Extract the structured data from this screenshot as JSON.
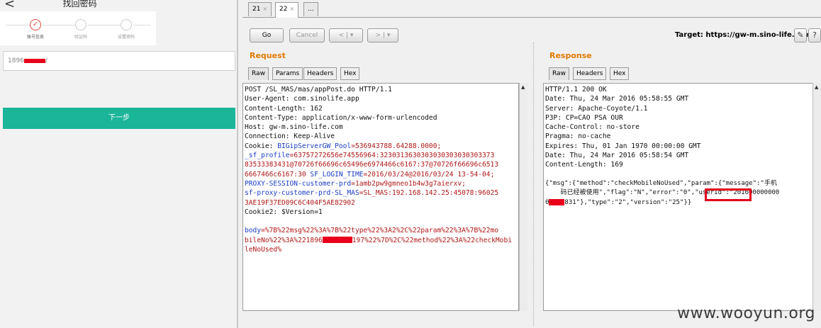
{
  "mobile": {
    "back_glyph": "<",
    "title": "找回密码",
    "steps": [
      "账号信息",
      "验证码",
      "设置密码"
    ],
    "step_done_glyph": "✓",
    "phone_prefix": "1896",
    "phone_suffix": "/",
    "next_label": "下一步"
  },
  "burp": {
    "tabs": [
      {
        "label": "21",
        "close": "×"
      },
      {
        "label": "22",
        "close": "×"
      },
      {
        "label": "...",
        "close": ""
      }
    ],
    "toolbar": {
      "go": "Go",
      "cancel": "Cancel",
      "back": "< | ▾",
      "forward": "> | ▾",
      "target": "Target: https://gw-m.sino-life.com",
      "edit_glyph": "✎",
      "help_glyph": "?"
    },
    "request": {
      "heading": "Request",
      "tabs": [
        "Raw",
        "Params",
        "Headers",
        "Hex"
      ],
      "lines": [
        "POST /SL_MAS/mas/appPost.do HTTP/1.1",
        "User-Agent: com.sinolife.app",
        "Content-Length: 162",
        "Content-Type: application/x-www-form-urlencoded",
        "Host: gw-m.sino-life.com",
        "Connection: Keep-Alive"
      ],
      "cookie_label": "Cookie: ",
      "cookie_lines": [
        {
          "k": "BIGipServerGW_Pool",
          "v": "=536943788.64288.0000;"
        },
        {
          "k": "_sf_profile",
          "v": "=63757272656e74556964:3230313630303030303030303373"
        },
        {
          "k": "",
          "v": "83533383431@70726f66696c65496e6974466c6167:37@70726f66696c6513"
        },
        {
          "k": "",
          "v": "6667466c6167:30 "
        },
        {
          "k": "SF_LOGIN_TIME",
          "v": "=2016/03/24@2016/03/24 13-54-04;"
        },
        {
          "k": "PROXY-SESSION-customer-prd",
          "v": "=1amb2pw9gmneo1b4w3g7aierxv;"
        },
        {
          "k": "sf-proxy-customer-prd-SL_MAS",
          "v": "=SL_MAS:192.168.142.25:45078:96025"
        },
        {
          "k": "",
          "v": "3AE19F37ED09C6C404F5AE82902"
        }
      ],
      "cookie2": "Cookie2: $Version=1",
      "body_key": "body",
      "body_line1": "=%7B%22msg%22%3A%7B%22type%22%3A2%2C%22param%22%3A%7B%22mo",
      "body_line2a": "bileNo%22%3A%221896",
      "body_line2b": "197%22%7D%2C%22method%22%3A%22checkMobi",
      "body_line3": "leNoUsed%"
    },
    "response": {
      "heading": "Response",
      "tabs": [
        "Raw",
        "Headers",
        "Hex"
      ],
      "lines": [
        "HTTP/1.1 200 OK",
        "Date: Thu, 24 Mar 2016 05:58:55 GMT",
        "Server: Apache-Coyote/1.1",
        "P3P: CP=CAO PSA OUR",
        "Cache-Control: no-store",
        "Pragma: no-cache",
        "Expires: Thu, 01 Jan 1970 00:00:00 GMT",
        "Date: Thu, 24 Mar 2016 05:58:54 GMT",
        "Content-Length: 169"
      ],
      "json_line1": "{\"msg\":{\"method\":\"checkMobileNoUsed\",\"param\":{\"message\":\"手机",
      "json_line2": "    码已经被使用\",\"flag\":\"N\",\"error\":\"0\",\"userId\":\"201600000000",
      "json_line3a": "0",
      "json_line3b": "831\"},\"type\":\"2\",\"version\":\"25\"}}"
    }
  },
  "watermark": "www.wooyun.org"
}
